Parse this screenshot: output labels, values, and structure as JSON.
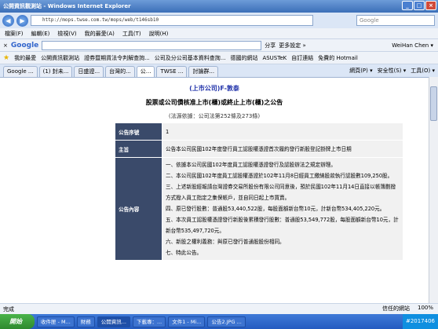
{
  "window": {
    "title": "公開資訊觀測站 - Windows Internet Explorer"
  },
  "address": {
    "url": "http://mops.twse.com.tw/mops/web/t146sb10",
    "search_placeholder": "Google"
  },
  "menu": [
    "檔案(F)",
    "編輯(E)",
    "檢視(V)",
    "我的最愛(A)",
    "工具(T)",
    "說明(H)"
  ],
  "google_bar": {
    "logo": "Google",
    "share": "分享",
    "more": "更多設定 »",
    "user": "WeiHan Chen ▾"
  },
  "favorites": [
    "我的最愛",
    "公開資訊觀測站",
    "證券暨期貨法令判解查詢...",
    "公司及分公司基本資料查詢...",
    "德國的網站",
    "ASUSTeK",
    "自訂連結",
    "免費的 Hotmail"
  ],
  "tabs": [
    "Google ...",
    "(1) 封未...",
    "日盛證...",
    "台灣的...",
    "公...",
    "TWSE ...",
    "討論群..."
  ],
  "tab_tools": [
    "網頁(P) ▾",
    "安全性(S) ▾",
    "工具(O) ▾"
  ],
  "page": {
    "company": "(上市公司)F-敦泰",
    "title": "股票或公司債核准上市(櫃)或終止上市(櫃)之公告",
    "law": "(法源依據：公司法第252條及273條)",
    "rows": [
      {
        "label": "公告序號",
        "value": "1"
      },
      {
        "label": "主旨",
        "value": "公告本公司民國102年度發行員工認股權憑證首次履約發行新股登記掛牌上市日期"
      },
      {
        "label": "公告內容",
        "value": "一、依據本公司民國102年度員工認股權憑證發行及認股辦法之規定辦理。\n二、本公司民國102年度員工認股權憑證於102年11月8日經員工繳納股款執行認股數109,250股。\n三、上述新股經報請台灣證券交易所股份有限公司同意後，預於民國102年11月14日直接以帳簿劃撥方式撥入員工指定之集保帳戶，並自同日起上市買賣。\n四、原已發行股數：普通股53,440,522股，每股面額新台幣10元，計新台幣534,405,220元。\n五、本次員工認股權憑證發行新股後累積發行股數：普通股53,549,772股，每股面額新台幣10元，計新台幣535,497,720元。\n六、新股之權利義務：與原已發行普通股股份相同。\n七、特此公告。"
      }
    ]
  },
  "status": {
    "left": "完成",
    "zone": "信任的網站",
    "zoom": "100%"
  },
  "taskbar": {
    "start": "開始",
    "tasks": [
      "收件匣 - M...",
      "財務",
      "公開資訊...",
      "下載專：...",
      "文件1 - Mi...",
      "公告2.JPG ..."
    ],
    "tray": "#2017406"
  }
}
